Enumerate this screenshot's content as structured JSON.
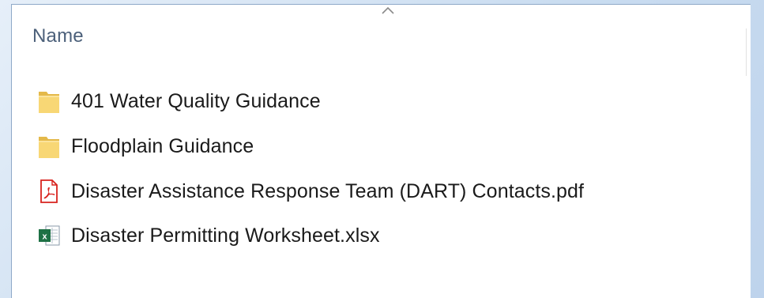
{
  "explorer": {
    "column_header": "Name",
    "sort_direction": "ascending",
    "files": [
      {
        "name": "401 Water Quality Guidance",
        "type": "folder",
        "icon": "folder-icon"
      },
      {
        "name": "Floodplain Guidance",
        "type": "folder",
        "icon": "folder-icon"
      },
      {
        "name": "Disaster Assistance Response Team (DART) Contacts.pdf",
        "type": "pdf",
        "icon": "pdf-file-icon"
      },
      {
        "name": "Disaster Permitting Worksheet.xlsx",
        "type": "xlsx",
        "icon": "excel-file-icon"
      }
    ]
  },
  "colors": {
    "folder": "#f8d775",
    "folder_dark": "#e4b94a",
    "pdf_red": "#d8231e",
    "excel_green": "#1e7145",
    "header_text": "#4c607a"
  }
}
